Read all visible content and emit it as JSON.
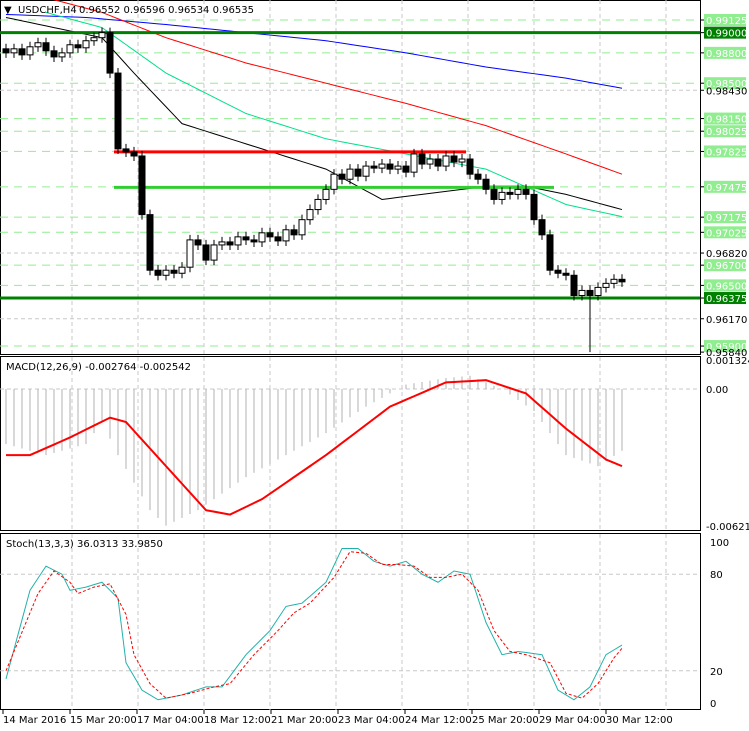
{
  "header": {
    "symbol_label": "USDCHF,H4",
    "ohlc": "0.96552 0.96596 0.96534 0.96535"
  },
  "macd_label": "MACD(12,26,9) -0.002764 -0.002542",
  "stoch_label": "Stoch(13,3,3) 36.0313 33.9850",
  "price_axis": {
    "levels": [
      {
        "text": "0.99125",
        "kind": "light"
      },
      {
        "text": "0.99000",
        "kind": "dark"
      },
      {
        "text": "0.98800",
        "kind": "light"
      },
      {
        "text": "0.98500",
        "kind": "light"
      },
      {
        "text": "0.98430",
        "kind": "plain"
      },
      {
        "text": "0.98150",
        "kind": "light"
      },
      {
        "text": "0.98025",
        "kind": "light"
      },
      {
        "text": "0.97825",
        "kind": "light"
      },
      {
        "text": "0.97475",
        "kind": "light"
      },
      {
        "text": "0.97175",
        "kind": "light"
      },
      {
        "text": "0.97025",
        "kind": "light"
      },
      {
        "text": "0.96820",
        "kind": "plain"
      },
      {
        "text": "0.96700",
        "kind": "light"
      },
      {
        "text": "0.96500",
        "kind": "light"
      },
      {
        "text": "0.96375",
        "kind": "dark"
      },
      {
        "text": "0.96170",
        "kind": "plain"
      },
      {
        "text": "0.95900",
        "kind": "light"
      },
      {
        "text": "0.95840",
        "kind": "plain"
      }
    ]
  },
  "macd_axis": [
    "0.001324",
    "0.00",
    "-0.006218"
  ],
  "stoch_axis": [
    "100",
    "80",
    "20",
    "0"
  ],
  "time_axis": [
    "14 Mar 2016",
    "15 Mar 20:00",
    "17 Mar 04:00",
    "18 Mar 12:00",
    "21 Mar 20:00",
    "23 Mar 04:00",
    "24 Mar 12:00",
    "25 Mar 20:00",
    "29 Mar 04:00",
    "30 Mar 12:00"
  ],
  "colors": {
    "up": "#ffffff",
    "down": "#000000",
    "green_level": "#008000",
    "bright_green": "#32cd32",
    "red_level": "#ff0000",
    "ma_blue": "#0000ff",
    "ma_red": "#ff0000",
    "ma_aqua": "#00e08a",
    "ma_black": "#000000",
    "macd_signal": "#ff0000",
    "stoch_main": "#20b2aa",
    "stoch_signal": "#ff0000",
    "tag_light": "#90ee90",
    "tag_dark": "#008000"
  },
  "chart_data": {
    "type": "candlestick",
    "symbol": "USDCHF",
    "timeframe": "H4",
    "closes": [
      0.988,
      0.9884,
      0.9878,
      0.9886,
      0.989,
      0.9882,
      0.9876,
      0.988,
      0.9888,
      0.9885,
      0.9892,
      0.9895,
      0.99,
      0.986,
      0.9785,
      0.9782,
      0.9778,
      0.972,
      0.9665,
      0.966,
      0.9665,
      0.9662,
      0.9668,
      0.9695,
      0.969,
      0.9675,
      0.969,
      0.9693,
      0.969,
      0.9698,
      0.9695,
      0.9693,
      0.9702,
      0.9698,
      0.9694,
      0.9705,
      0.97,
      0.9715,
      0.9725,
      0.9735,
      0.9745,
      0.976,
      0.9755,
      0.9765,
      0.9758,
      0.9768,
      0.9766,
      0.977,
      0.9765,
      0.9768,
      0.9762,
      0.978,
      0.977,
      0.9775,
      0.9768,
      0.9778,
      0.9772,
      0.9775,
      0.976,
      0.9755,
      0.9745,
      0.9735,
      0.9742,
      0.974,
      0.9745,
      0.974,
      0.9715,
      0.97,
      0.9665,
      0.9662,
      0.966,
      0.964,
      0.9645,
      0.964,
      0.9648,
      0.9652,
      0.9656,
      0.96535
    ],
    "extreme_low": {
      "index": 73,
      "price": 0.9584
    },
    "ylim": [
      0.9584,
      0.99132
    ],
    "horizontal_levels": [
      {
        "price": 0.99,
        "color": "green"
      },
      {
        "price": 0.96375,
        "color": "green"
      },
      {
        "price": 0.9782,
        "color": "red",
        "from": 14,
        "to": 57
      },
      {
        "price": 0.9747,
        "color": "bright_green",
        "from": 14,
        "to": 68
      }
    ],
    "moving_averages": {
      "blue": [
        [
          0,
          0.9918
        ],
        [
          10,
          0.9915
        ],
        [
          20,
          0.9908
        ],
        [
          30,
          0.99
        ],
        [
          40,
          0.9892
        ],
        [
          50,
          0.988
        ],
        [
          60,
          0.9866
        ],
        [
          70,
          0.9855
        ],
        [
          77,
          0.9845
        ]
      ],
      "red": [
        [
          0,
          0.9945
        ],
        [
          12,
          0.992
        ],
        [
          20,
          0.9895
        ],
        [
          30,
          0.987
        ],
        [
          40,
          0.985
        ],
        [
          50,
          0.983
        ],
        [
          60,
          0.9808
        ],
        [
          70,
          0.978
        ],
        [
          77,
          0.976
        ]
      ],
      "aqua": [
        [
          5,
          0.992
        ],
        [
          12,
          0.9905
        ],
        [
          20,
          0.986
        ],
        [
          30,
          0.982
        ],
        [
          40,
          0.9795
        ],
        [
          50,
          0.978
        ],
        [
          60,
          0.9765
        ],
        [
          70,
          0.973
        ],
        [
          77,
          0.9718
        ]
      ],
      "black": [
        [
          0,
          0.9915
        ],
        [
          12,
          0.9895
        ],
        [
          16,
          0.986
        ],
        [
          22,
          0.981
        ],
        [
          30,
          0.979
        ],
        [
          40,
          0.9765
        ],
        [
          47,
          0.9735
        ],
        [
          52,
          0.974
        ],
        [
          60,
          0.9748
        ],
        [
          65,
          0.9748
        ],
        [
          70,
          0.974
        ],
        [
          77,
          0.9725
        ]
      ]
    },
    "macd": {
      "ylim": [
        -0.006218,
        0.001324
      ],
      "histogram": [
        [
          0,
          -0.0025
        ],
        [
          5,
          -0.003
        ],
        [
          10,
          -0.0025
        ],
        [
          12,
          -0.0015
        ],
        [
          14,
          -0.003
        ],
        [
          18,
          -0.0055
        ],
        [
          20,
          -0.0062
        ],
        [
          24,
          -0.0055
        ],
        [
          30,
          -0.004
        ],
        [
          40,
          -0.002
        ],
        [
          45,
          -0.0008
        ],
        [
          50,
          0.0002
        ],
        [
          55,
          0.0005
        ],
        [
          58,
          0.0006
        ],
        [
          62,
          0.0
        ],
        [
          66,
          -0.001
        ],
        [
          70,
          -0.003
        ],
        [
          74,
          -0.0035
        ],
        [
          77,
          -0.0028
        ]
      ],
      "signal": [
        [
          0,
          -0.003
        ],
        [
          3,
          -0.003
        ],
        [
          8,
          -0.0022
        ],
        [
          13,
          -0.0013
        ],
        [
          15,
          -0.0015
        ],
        [
          20,
          -0.0035
        ],
        [
          25,
          -0.0055
        ],
        [
          28,
          -0.0057
        ],
        [
          32,
          -0.005
        ],
        [
          40,
          -0.003
        ],
        [
          48,
          -0.0008
        ],
        [
          55,
          0.0003
        ],
        [
          60,
          0.0004
        ],
        [
          65,
          -0.0002
        ],
        [
          70,
          -0.0018
        ],
        [
          75,
          -0.0032
        ],
        [
          77,
          -0.0035
        ]
      ]
    },
    "stoch": {
      "ylim": [
        0,
        100
      ],
      "main": [
        [
          0,
          15
        ],
        [
          3,
          70
        ],
        [
          5,
          85
        ],
        [
          7,
          80
        ],
        [
          8,
          70
        ],
        [
          10,
          72
        ],
        [
          12,
          75
        ],
        [
          14,
          65
        ],
        [
          15,
          25
        ],
        [
          17,
          8
        ],
        [
          19,
          2
        ],
        [
          22,
          5
        ],
        [
          25,
          10
        ],
        [
          27,
          10
        ],
        [
          30,
          30
        ],
        [
          33,
          45
        ],
        [
          35,
          60
        ],
        [
          37,
          62
        ],
        [
          40,
          75
        ],
        [
          42,
          96
        ],
        [
          44,
          96
        ],
        [
          46,
          88
        ],
        [
          48,
          85
        ],
        [
          50,
          88
        ],
        [
          52,
          80
        ],
        [
          54,
          75
        ],
        [
          56,
          82
        ],
        [
          58,
          80
        ],
        [
          60,
          50
        ],
        [
          62,
          30
        ],
        [
          64,
          32
        ],
        [
          67,
          30
        ],
        [
          69,
          8
        ],
        [
          71,
          2
        ],
        [
          73,
          10
        ],
        [
          75,
          30
        ],
        [
          77,
          36
        ]
      ],
      "signal": [
        [
          0,
          20
        ],
        [
          4,
          68
        ],
        [
          6,
          82
        ],
        [
          8,
          75
        ],
        [
          9,
          68
        ],
        [
          11,
          72
        ],
        [
          13,
          74
        ],
        [
          15,
          55
        ],
        [
          16,
          30
        ],
        [
          18,
          12
        ],
        [
          20,
          3
        ],
        [
          23,
          6
        ],
        [
          26,
          10
        ],
        [
          28,
          12
        ],
        [
          31,
          30
        ],
        [
          34,
          45
        ],
        [
          36,
          56
        ],
        [
          38,
          62
        ],
        [
          41,
          78
        ],
        [
          43,
          94
        ],
        [
          45,
          93
        ],
        [
          47,
          86
        ],
        [
          49,
          86
        ],
        [
          51,
          85
        ],
        [
          53,
          78
        ],
        [
          55,
          78
        ],
        [
          57,
          80
        ],
        [
          59,
          70
        ],
        [
          61,
          45
        ],
        [
          63,
          32
        ],
        [
          65,
          30
        ],
        [
          68,
          25
        ],
        [
          70,
          6
        ],
        [
          72,
          3
        ],
        [
          74,
          12
        ],
        [
          76,
          28
        ],
        [
          77,
          34
        ]
      ]
    }
  }
}
